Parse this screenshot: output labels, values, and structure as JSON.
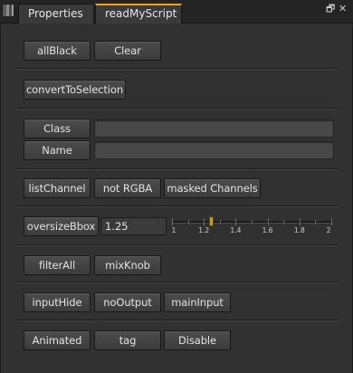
{
  "tabs": [
    "Properties",
    "readMyScript"
  ],
  "window_controls": {
    "float_glyph": "🗗",
    "close_glyph": "✕"
  },
  "row1": {
    "allBlack": "allBlack",
    "clear": "Clear"
  },
  "row2": {
    "convertToSelection": "convertToSelection"
  },
  "row3": {
    "class_label": "Class",
    "class_value": "",
    "name_label": "Name",
    "name_value": ""
  },
  "row4": {
    "listChannel": "listChannel",
    "notRGBA": "not RGBA",
    "maskedChannels": "masked Channels"
  },
  "row5": {
    "oversizeBbox": "oversizeBbox",
    "value": "1.25",
    "slider_min": 1,
    "slider_max": 2,
    "slider_ticks": [
      "1",
      "1.2",
      "1.4",
      "1.6",
      "1.8",
      "2"
    ]
  },
  "row6": {
    "filterAll": "filterAll",
    "mixKnob": "mixKnob"
  },
  "row7": {
    "inputHide": "inputHide",
    "noOutput": "noOutput",
    "mainInput": "mainInput"
  },
  "row8": {
    "animated": "Animated",
    "tag": "tag",
    "disable": "Disable"
  },
  "colors": {
    "accent": "#f0a020",
    "slider_handle": "#c89a30",
    "background": "#313131"
  }
}
